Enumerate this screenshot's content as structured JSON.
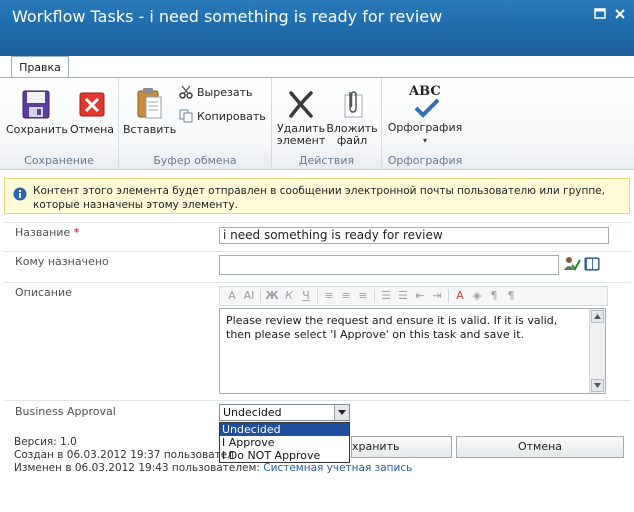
{
  "window": {
    "title": "Workflow Tasks - i need something is ready for review"
  },
  "tabs": [
    {
      "label": "Правка"
    }
  ],
  "ribbon": {
    "groups": [
      {
        "label": "Сохранение"
      },
      {
        "label": "Буфер обмена"
      },
      {
        "label": "Действия"
      },
      {
        "label": "Орфография"
      }
    ],
    "save_label": "Сохранить",
    "cancel_label": "Отмена",
    "paste_label": "Вставить",
    "cut_label": "Вырезать",
    "copy_label": "Копировать",
    "delete_label_1": "Удалить",
    "delete_label_2": "элемент",
    "attach_label_1": "Вложить",
    "attach_label_2": "файл",
    "spelling_label": "Орфография",
    "spelling_icon_text": "ABC"
  },
  "info": {
    "text": "Контент этого элемента будет отправлен в сообщении электронной почты пользователю или группе, которые назначены этому элементу."
  },
  "form": {
    "title_label": "Название",
    "required_mark": " *",
    "title_value": "i need something is ready for review",
    "assigned_label": "Кому назначено",
    "assigned_value": "",
    "description_label": "Описание",
    "description_value": "Please review the request and ensure it is valid. If it is valid, then please select 'I Approve' on this task and save it.",
    "approval_label": "Business Approval",
    "approval_selected": "Undecided",
    "approval_options": [
      "Undecided",
      "I Approve",
      "I Do NOT Approve"
    ]
  },
  "meta": {
    "version": "Версия: 1.0",
    "created": "Создан в 06.03.2012 19:37 пользовател",
    "modified": "Изменен в 06.03.2012 19:43 пользователем: ",
    "modified_user": "Системная учетная запись"
  },
  "buttons": {
    "save_partial": "хранить",
    "cancel": "Отмена"
  },
  "colors": {
    "titlebar": "#1f6aa9",
    "link": "#1f5fa0",
    "info_bg": "#fffbd8",
    "required": "#c00000"
  }
}
